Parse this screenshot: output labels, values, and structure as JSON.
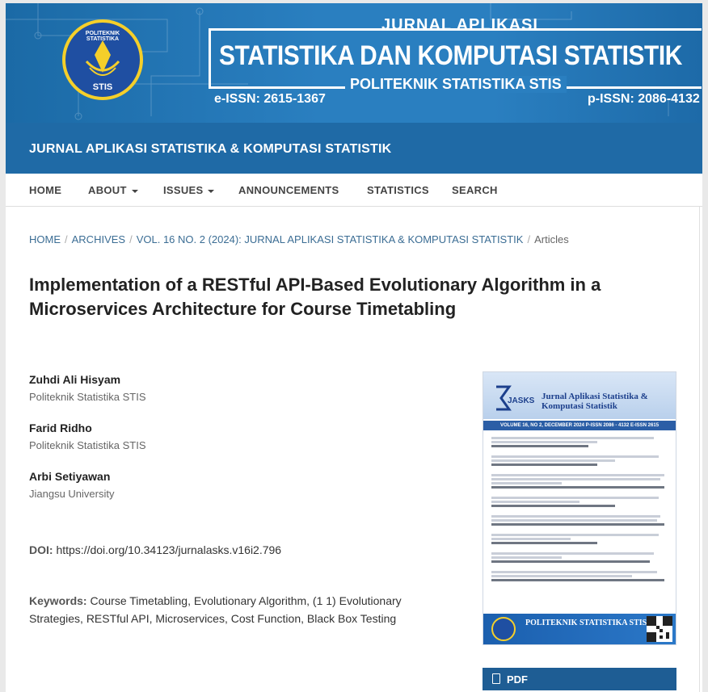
{
  "banner": {
    "logo_text_top": "POLITEKNIK STATISTIKA",
    "logo_text_bottom": "STIS",
    "heading_small": "JURNAL APLIKASI",
    "heading_big": "STATISTIKA DAN KOMPUTASI STATISTIK",
    "heading_sub": "POLITEKNIK STATISTIKA STIS",
    "e_issn": "e-ISSN: 2615-1367",
    "p_issn": "p-ISSN: 2086-4132"
  },
  "site_name": "JURNAL APLIKASI STATISTIKA & KOMPUTASI STATISTIK",
  "nav": {
    "home": "HOME",
    "about": "ABOUT",
    "issues": "ISSUES",
    "announcements": "ANNOUNCEMENTS",
    "statistics": "STATISTICS",
    "search": "SEARCH"
  },
  "breadcrumb": {
    "home": "HOME",
    "archives": "ARCHIVES",
    "issue": "VOL. 16 NO. 2 (2024): JURNAL APLIKASI STATISTIKA & KOMPUTASI STATISTIK",
    "current": "Articles"
  },
  "article": {
    "title": "Implementation of a RESTful API-Based Evolutionary Algorithm in a Microservices Architecture for Course Timetabling",
    "authors": [
      {
        "name": "Zuhdi Ali Hisyam",
        "affiliation": "Politeknik Statistika STIS"
      },
      {
        "name": "Farid Ridho",
        "affiliation": "Politeknik Statistika STIS"
      },
      {
        "name": "Arbi Setiyawan",
        "affiliation": "Jiangsu University"
      }
    ],
    "doi_label": "DOI:",
    "doi_value": "https://doi.org/10.34123/jurnalasks.v16i2.796",
    "keywords_label": "Keywords:",
    "keywords_value": "Course Timetabling, Evolutionary Algorithm, (1 1) Evolutionary Strategies, RESTful API, Microservices, Cost Function, Black Box Testing"
  },
  "cover": {
    "title": "Jurnal Aplikasi Statistika & Komputasi Statistik",
    "band": "VOLUME 16, NO 2, DECEMBER 2024 P-ISSN 2086 - 4132 E-ISSN 2615",
    "footer": "POLITEKNIK STATISTIKA STIS",
    "logo_text": "JASKS"
  },
  "pdf_button": "PDF",
  "colors": {
    "banner": "#2a7fc0",
    "titlebar": "#1f6aa6",
    "link": "#3b6d94",
    "pdf_button": "#1e5d94"
  }
}
